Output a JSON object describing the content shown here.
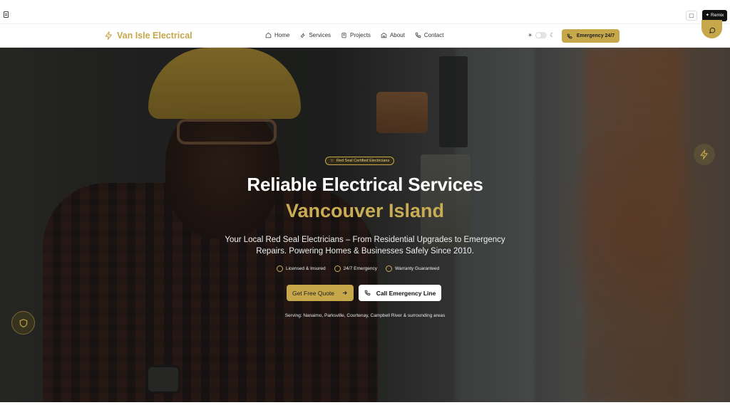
{
  "preview": {
    "remix_label": "Remix",
    "icons": [
      "document-icon",
      "chat-icon",
      "sparkle-icon"
    ]
  },
  "header": {
    "brand": "Van Isle Electrical",
    "nav": [
      {
        "label": "Home",
        "icon": "home-icon"
      },
      {
        "label": "Services",
        "icon": "wrench-icon"
      },
      {
        "label": "Projects",
        "icon": "clipboard-icon"
      },
      {
        "label": "About",
        "icon": "building-icon"
      },
      {
        "label": "Contact",
        "icon": "phone-icon"
      }
    ],
    "emergency_label": "Emergency 24/7"
  },
  "hero": {
    "badge": "Red Seal Certified Electricians",
    "title_line1": "Reliable Electrical Services",
    "title_line2": "Vancouver Island",
    "subtitle": "Your Local Red Seal Electricians – From Residential Upgrades to Emergency Repairs. Powering Homes & Businesses Safely Since 2010.",
    "features": [
      "Licensed & Insured",
      "24/7 Emergency",
      "Warranty Guaranteed"
    ],
    "primary_cta": "Get Free Quote",
    "secondary_cta": "Call Emergency Line",
    "serving": "Serving: Nanaimo, Parksville, Courtenay, Campbell River & surrounding areas"
  },
  "colors": {
    "accent": "#c6a84b",
    "accent_text": "#c9ad54",
    "dark": "#111111",
    "white": "#ffffff"
  }
}
